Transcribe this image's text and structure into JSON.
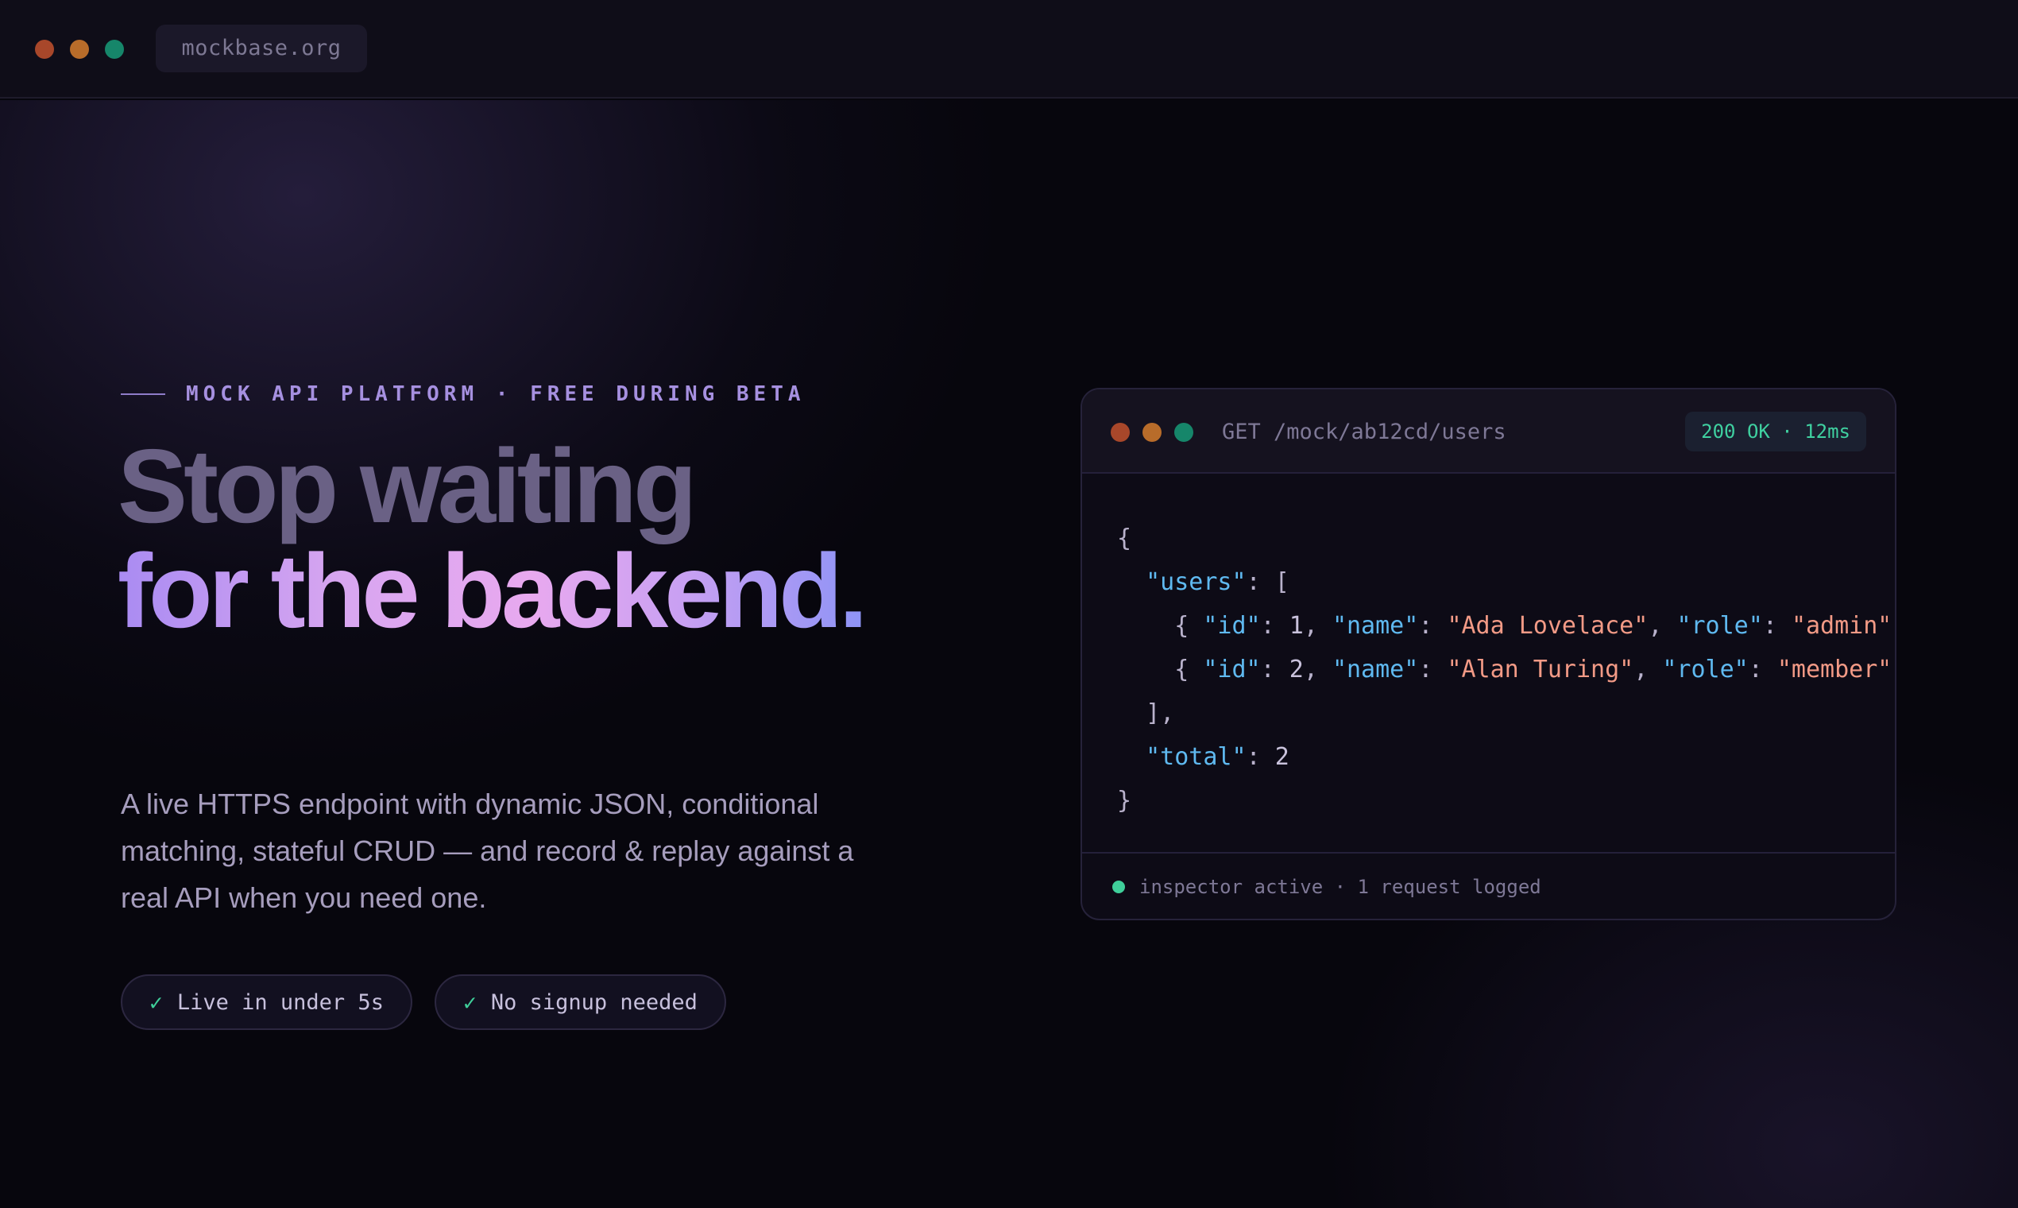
{
  "browser": {
    "url": "mockbase.org"
  },
  "hero": {
    "eyebrow": "MOCK API PLATFORM · FREE DURING BETA",
    "headline_line1": "Stop waiting",
    "headline_line2": "for the backend.",
    "subtext": "A live HTTPS endpoint with dynamic JSON, conditional matching, stateful CRUD — and record & replay against a real API when you need one.",
    "pills": [
      {
        "icon": "check-icon",
        "label": "Live in under 5s"
      },
      {
        "icon": "check-icon",
        "label": "No signup needed"
      }
    ]
  },
  "panel": {
    "endpoint": "GET /mock/ab12cd/users",
    "status": "200 OK · 12ms",
    "response": {
      "open_brace": "{",
      "users_key": "\"users\"",
      "open_bracket": "[",
      "users": [
        {
          "id": "1",
          "name": "\"Ada Lovelace\"",
          "role": "\"admin\""
        },
        {
          "id": "2",
          "name": "\"Alan Turing\"",
          "role": "\"member\""
        }
      ],
      "close_bracket": "],",
      "total_key": "\"total\"",
      "total_value": "2",
      "close_brace": "}"
    },
    "footer": "inspector active · 1 request logged"
  },
  "colors": {
    "accent_purple": "#a98bf2",
    "accent_pink": "#e8a9ef",
    "success_green": "#3fcf9a",
    "json_key": "#5fb9f0",
    "json_string": "#f29a86"
  }
}
